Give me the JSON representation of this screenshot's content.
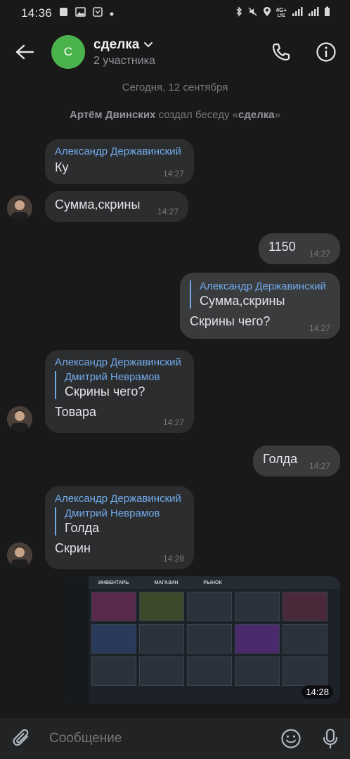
{
  "status": {
    "time": "14:36",
    "network": "4G+",
    "net_small": "LTE"
  },
  "header": {
    "avatar_letter": "С",
    "title": "сделка",
    "subtitle": "2 участника"
  },
  "date_separator": "Сегодня, 12 сентября",
  "service": {
    "author": "Артём Двинских",
    "text": " создал беседу «",
    "chat": "сделка",
    "close": "»"
  },
  "messages": [
    {
      "sender": "Александр Державинский",
      "text": "Ку",
      "time": "14:27"
    },
    {
      "text": "Сумма,скрины",
      "time": "14:27"
    },
    {
      "text": "1150",
      "time": "14:27"
    },
    {
      "reply_name": "Александр Державинский",
      "reply_text": "Сумма,скрины",
      "text": "Скрины чего?",
      "time": "14:27"
    },
    {
      "sender": "Александр Державинский",
      "reply_name": "Дмитрий Неврамов",
      "reply_text": "Скрины чего?",
      "text": "Товара",
      "time": "14:27"
    },
    {
      "text": "Голда",
      "time": "14:27"
    },
    {
      "sender": "Александр Державинский",
      "reply_name": "Дмитрий Неврамов",
      "reply_text": "Голда",
      "text": "Скрин",
      "time": "14:28"
    }
  ],
  "image_message": {
    "tabs": [
      "ИНВЕНТАРЬ",
      "МАГАЗИН",
      "РЫНОК"
    ],
    "time": "14:28"
  },
  "input": {
    "placeholder": "Сообщение"
  },
  "colors": {
    "background": "#19191a",
    "bubble_in": "#2c2d2e",
    "bubble_out": "#3a3b3c",
    "accent": "#71aaeb",
    "avatar_green": "#4bb34b"
  }
}
